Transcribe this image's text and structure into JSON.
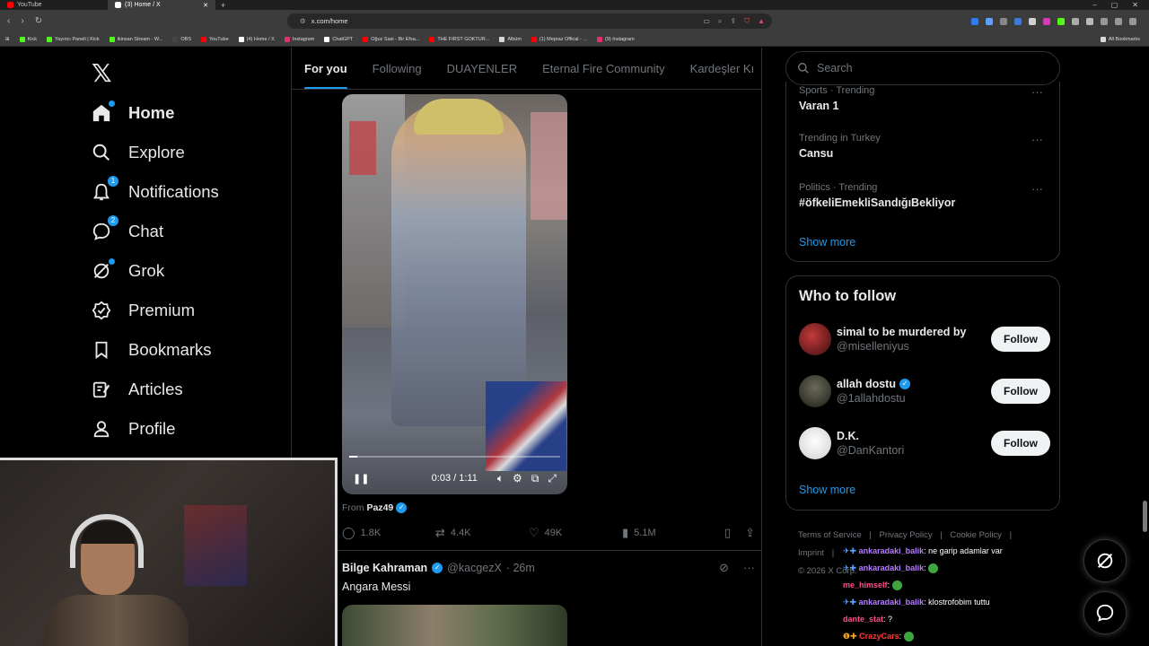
{
  "browser": {
    "tabs": [
      {
        "title": "YouTube",
        "color": "#ff0000",
        "active": false
      },
      {
        "title": "(3) Home / X",
        "color": "#ffffff",
        "active": true
      }
    ],
    "new_tab": "+",
    "window_controls": [
      "–",
      "▢",
      "✕"
    ],
    "url": "x.com/home",
    "bookmarks": [
      {
        "label": "Kick",
        "color": "#53fc18"
      },
      {
        "label": "Yayıncı Paneli | Kick",
        "color": "#53fc18"
      },
      {
        "label": "ikinsan Stream - W...",
        "color": "#53fc18"
      },
      {
        "label": "OBS",
        "color": "#444444"
      },
      {
        "label": "YouTube",
        "color": "#ff0000"
      },
      {
        "label": "(4) Home / X",
        "color": "#ffffff"
      },
      {
        "label": "Instagram",
        "color": "#e1306c"
      },
      {
        "label": "ChatGPT",
        "color": "#ffffff"
      },
      {
        "label": "Oğuz Sasi - Bir Efsa...",
        "color": "#ff0000"
      },
      {
        "label": "THE FIRST GOKTUR...",
        "color": "#ff0000"
      },
      {
        "label": "Albüm",
        "color": "#d9d9d9"
      },
      {
        "label": "(1) Mepraz Offical - ...",
        "color": "#ff0000"
      },
      {
        "label": "(9) Instagram",
        "color": "#e1306c"
      }
    ],
    "all_bookmarks": "All Bookmarks"
  },
  "nav": {
    "logo": "𝕏",
    "items": [
      {
        "label": "Home",
        "icon": "home-icon",
        "glyph": "⌂",
        "badge": "",
        "dot": true
      },
      {
        "label": "Explore",
        "icon": "search-icon",
        "glyph": "⌕",
        "badge": "",
        "dot": false
      },
      {
        "label": "Notifications",
        "icon": "bell-icon",
        "glyph": "🔔︎",
        "badge": "1",
        "dot": false
      },
      {
        "label": "Chat",
        "icon": "chat-icon",
        "glyph": "◯",
        "badge": "2",
        "dot": false
      },
      {
        "label": "Grok",
        "icon": "grok-icon",
        "glyph": "⊘",
        "badge": "",
        "dot": true
      },
      {
        "label": "Premium",
        "icon": "premium-icon",
        "glyph": "✪",
        "badge": "",
        "dot": false
      },
      {
        "label": "Bookmarks",
        "icon": "bookmark-icon",
        "glyph": "▯",
        "badge": "",
        "dot": false
      },
      {
        "label": "Articles",
        "icon": "articles-icon",
        "glyph": "✎",
        "badge": "",
        "dot": false
      },
      {
        "label": "Profile",
        "icon": "profile-icon",
        "glyph": "♙",
        "badge": "",
        "dot": false
      }
    ]
  },
  "feed": {
    "tabs": [
      "For you",
      "Following",
      "DUAYENLER",
      "Eternal Fire Community",
      "Kardeşler Kı"
    ],
    "video": {
      "time": "0:03 / 1:11",
      "progress": 0.04
    },
    "from_label": "From",
    "from_user": "Paz49",
    "stats": {
      "replies": "1.8K",
      "reposts": "4.4K",
      "likes": "49K",
      "views": "5.1M"
    },
    "tweet2": {
      "name": "Bilge Kahraman",
      "handle": "@kacgezX",
      "time": "· 26m",
      "text": "Angara Messi"
    }
  },
  "right": {
    "search_placeholder": "Search",
    "trends": [
      {
        "category": "Sports · Trending",
        "title": "Varan 1"
      },
      {
        "category": "Trending in Turkey",
        "title": "Cansu"
      },
      {
        "category": "Politics · Trending",
        "title": "#öfkeliEmekliSandığıBekliyor"
      }
    ],
    "show_more": "Show more",
    "who_to_follow": "Who to follow",
    "follow_button": "Follow",
    "suggestions": [
      {
        "name": "simal to be murdered by",
        "handle": "@miselleniyus",
        "verified": false,
        "avatar_color": "#8a1f24"
      },
      {
        "name": "allah dostu",
        "handle": "@1allahdostu",
        "verified": true,
        "avatar_color": "#3a3a2a"
      },
      {
        "name": "D.K.",
        "handle": "@DanKantori",
        "verified": false,
        "avatar_color": "#f2f2f2"
      }
    ],
    "footer": [
      "Terms of Service",
      "|",
      "Privacy Policy",
      "|",
      "Cookie Policy",
      "|",
      "Imprint",
      "|",
      "© 2026 X Corp."
    ]
  },
  "chat_overlay": [
    {
      "user": "ankaradaki_balik",
      "msg": "ne garip adamlar var",
      "cls": "u1"
    },
    {
      "user": "ankaradaki_balik",
      "msg": "",
      "cls": "u1",
      "emote": true
    },
    {
      "user": "me_himself",
      "msg": "",
      "cls": "u2",
      "emote": true
    },
    {
      "user": "ankaradaki_balik",
      "msg": "klostrofobim tuttu",
      "cls": "u1"
    },
    {
      "user": "dante_stat",
      "msg": "?",
      "cls": "u2"
    },
    {
      "user": "CrazyCars",
      "msg": "",
      "cls": "u3",
      "emote": true
    }
  ]
}
